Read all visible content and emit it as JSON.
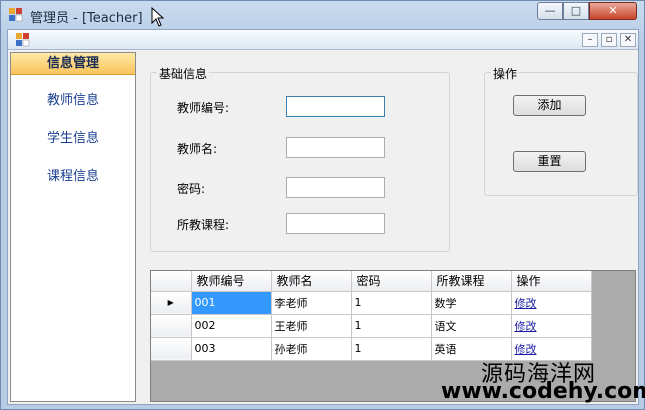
{
  "window": {
    "title": "管理员 - [Teacher]",
    "controls": {
      "min": "—",
      "max": "□",
      "close": "✕"
    }
  },
  "child_controls": {
    "min": "–",
    "restore": "▫",
    "close": "✕"
  },
  "nav": {
    "header": "信息管理",
    "items": [
      {
        "label": "教师信息"
      },
      {
        "label": "学生信息"
      },
      {
        "label": "课程信息"
      }
    ]
  },
  "basic_info": {
    "legend": "基础信息",
    "fields": [
      {
        "label": "教师编号:",
        "value": ""
      },
      {
        "label": "教师名:",
        "value": ""
      },
      {
        "label": "密码:",
        "value": ""
      },
      {
        "label": "所教课程:",
        "value": ""
      }
    ]
  },
  "operations": {
    "legend": "操作",
    "add_label": "添加",
    "reset_label": "重置"
  },
  "grid": {
    "columns": [
      "教师编号",
      "教师名",
      "密码",
      "所教课程",
      "操作"
    ],
    "rows": [
      {
        "id": "001",
        "name": "李老师",
        "password": "1",
        "course": "数学",
        "action": "修改"
      },
      {
        "id": "002",
        "name": "王老师",
        "password": "1",
        "course": "语文",
        "action": "修改"
      },
      {
        "id": "003",
        "name": "孙老师",
        "password": "1",
        "course": "英语",
        "action": "修改"
      }
    ],
    "current_row_indicator": "▶"
  },
  "watermark": {
    "line1": "源码海洋网",
    "line2": "www.codehy.com"
  }
}
